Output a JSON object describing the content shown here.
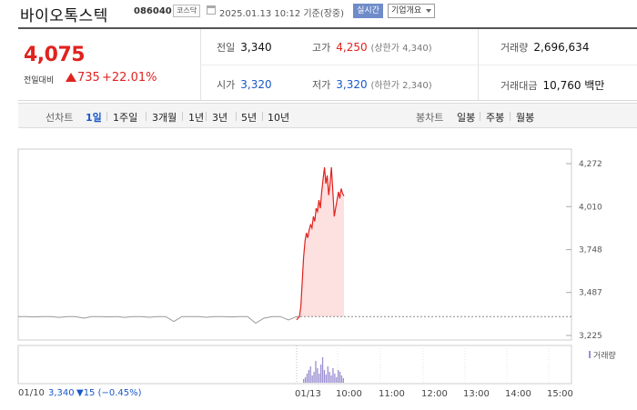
{
  "header": {
    "name": "바이오톡스텍",
    "code": "086040",
    "market": "코스닥",
    "datetime": "2025.01.13 10:12 기준(장중)",
    "realtime": "실시간",
    "overview": "기업개요"
  },
  "price": {
    "current": "4,075",
    "compare_label": "전일대비",
    "change": "735",
    "percent": "+22.01%"
  },
  "stats": {
    "prev_label": "전일",
    "prev": "3,340",
    "high_label": "고가",
    "high": "4,250",
    "high_limit": "(상한가 4,340)",
    "volume_label": "거래량",
    "volume": "2,696,634",
    "open_label": "시가",
    "open": "3,320",
    "low_label": "저가",
    "low": "3,320",
    "low_limit": "(하한가 2,340)",
    "amount_label": "거래대금",
    "amount": "10,760 백만"
  },
  "tabs": {
    "line_label": "선차트",
    "items": [
      "1일",
      "1주일",
      "3개월",
      "1년",
      "3년",
      "5년",
      "10년"
    ],
    "candle_label": "봉차트",
    "candle_items": [
      "일봉",
      "주봉",
      "월봉"
    ]
  },
  "chart_data": {
    "type": "line",
    "y_ticks": [
      "4,272",
      "4,010",
      "3,748",
      "3,487",
      "3,225"
    ],
    "ylim": [
      3225,
      4272
    ],
    "x_ticks": [
      "01/13",
      "10:00",
      "11:00",
      "12:00",
      "13:00",
      "14:00",
      "15:00"
    ],
    "prev_day": {
      "values": [
        3340,
        3340,
        3338,
        3340,
        3340,
        3335,
        3340,
        3340,
        3330,
        3340,
        3340,
        3338,
        3340,
        3335,
        3340,
        3340,
        3336,
        3340,
        3340,
        3310,
        3340,
        3340,
        3340,
        3336,
        3340,
        3340,
        3338,
        3340,
        3340,
        3300,
        3330,
        3340,
        3340,
        3320,
        3340
      ]
    },
    "today": {
      "values": [
        3320,
        3330,
        3340,
        3400,
        3550,
        3700,
        3800,
        3850,
        3820,
        3870,
        3900,
        3880,
        3950,
        3920,
        4000,
        3980,
        4050,
        4000,
        4100,
        4180,
        4250,
        4150,
        4200,
        4080,
        4150,
        4250,
        4100,
        3950,
        4000,
        4050,
        4100,
        4060,
        4120,
        4090,
        4075
      ]
    },
    "baseline": 3340,
    "volume_label": "거래량"
  },
  "footer": {
    "prev_date": "01/10",
    "prev_price": "3,340",
    "prev_change": "▼15 (−0.45%)"
  },
  "colors": {
    "up": "#e0231f",
    "down": "#1a58c8",
    "volume": "#9b8fd1"
  }
}
